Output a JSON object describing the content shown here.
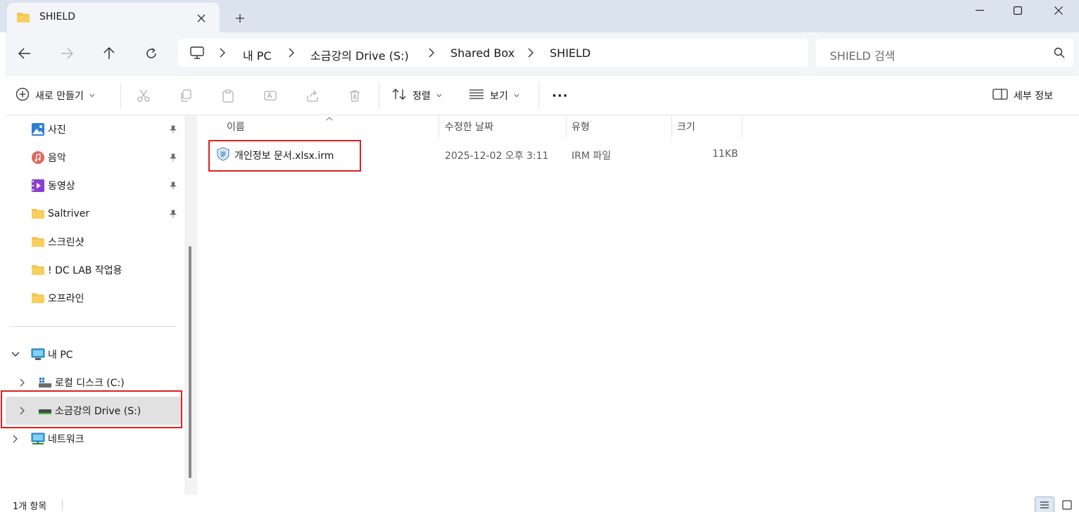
{
  "window": {
    "tab_title": "SHIELD",
    "new_tab": "+"
  },
  "breadcrumb": {
    "items": [
      "내 PC",
      "소금강의 Drive (S:)",
      "Shared Box",
      "SHIELD"
    ]
  },
  "search": {
    "placeholder": "SHIELD 검색"
  },
  "toolbar": {
    "new_label": "새로 만들기",
    "sort_label": "정렬",
    "view_label": "보기",
    "more_label": "···",
    "details_label": "세부 정보"
  },
  "sidebar": {
    "pinned": [
      {
        "label": "사진",
        "icon": "photos-icon"
      },
      {
        "label": "음악",
        "icon": "music-icon"
      },
      {
        "label": "동영상",
        "icon": "videos-icon"
      },
      {
        "label": "Saltriver",
        "icon": "folder-icon"
      }
    ],
    "folders": [
      {
        "label": "스크린샷",
        "icon": "folder-icon"
      },
      {
        "label": "! DC LAB 작업용",
        "icon": "folder-icon"
      },
      {
        "label": "오프라인",
        "icon": "folder-icon"
      }
    ],
    "this_pc": "내 PC",
    "local_disk": "로컬 디스크 (C:)",
    "drive_s": "소금강의 Drive (S:)",
    "network": "네트워크"
  },
  "columns": {
    "name": "이름",
    "modified": "수정한 날짜",
    "type": "유형",
    "size": "크기"
  },
  "files": [
    {
      "name": "개인정보 문서.xlsx.irm",
      "modified": "2025-12-02 오후 3:11",
      "type": "IRM 파일",
      "size": "11KB",
      "icon": "shield-file-icon"
    }
  ],
  "status": {
    "item_count": "1개 항목"
  },
  "colors": {
    "accent": "#0067c0",
    "highlight_box": "#e02020",
    "folder": "#f5c24a"
  }
}
